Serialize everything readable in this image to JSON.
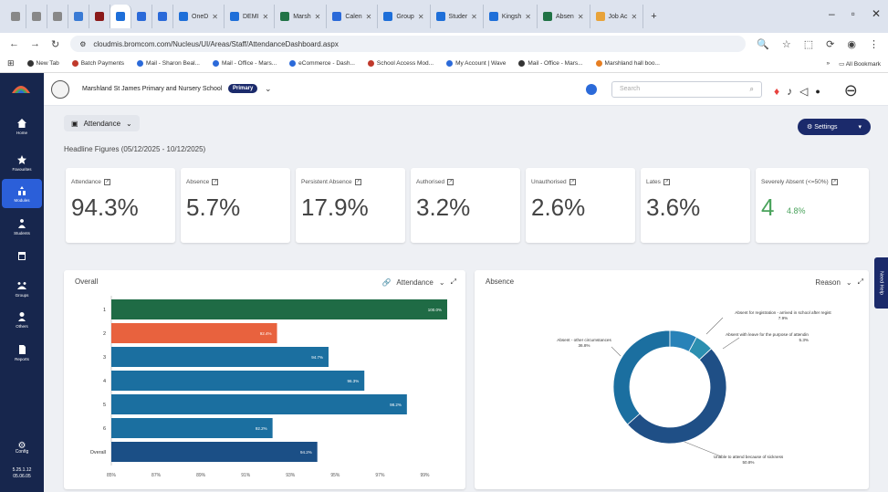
{
  "browser": {
    "tabs": [
      {
        "label": "",
        "color": "#888888"
      },
      {
        "label": "",
        "color": "#888888"
      },
      {
        "label": "",
        "color": "#888888"
      },
      {
        "label": "",
        "color": "#3a7bd5"
      },
      {
        "label": "",
        "color": "#8b1a1a"
      },
      {
        "label": "",
        "color": "#1e6fd9",
        "active": true
      },
      {
        "label": "",
        "color": "#2b6ad9"
      },
      {
        "label": "",
        "color": "#2b6ad9"
      },
      {
        "label": "OneD",
        "color": "#1e6fd9"
      },
      {
        "label": "DEMI",
        "color": "#1e6fd9"
      },
      {
        "label": "Marsh",
        "color": "#217346"
      },
      {
        "label": "Calen",
        "color": "#2b6ad9"
      },
      {
        "label": "Group",
        "color": "#1e6fd9"
      },
      {
        "label": "Studer",
        "color": "#1e6fd9"
      },
      {
        "label": "Kingsh",
        "color": "#1e6fd9"
      },
      {
        "label": "Absen",
        "color": "#217346"
      },
      {
        "label": "Job Ac",
        "color": "#e8a33a"
      }
    ],
    "url": "cloudmis.bromcom.com/Nucleus/UI/Areas/Staff/AttendanceDashboard.aspx",
    "bookmarks": [
      {
        "label": "New Tab",
        "color": "#333333"
      },
      {
        "label": "Batch Payments",
        "color": "#c0392b"
      },
      {
        "label": "Mail - Sharon Beal...",
        "color": "#2b6ad9"
      },
      {
        "label": "Mail - Office - Mars...",
        "color": "#2b6ad9"
      },
      {
        "label": "eCommerce - Dash...",
        "color": "#2b6ad9"
      },
      {
        "label": "School Access Mod...",
        "color": "#c0392b"
      },
      {
        "label": "My Account | Wave",
        "color": "#2b6ad9"
      },
      {
        "label": "Mail - Office - Mars...",
        "color": "#333333"
      },
      {
        "label": "Marshland hall boo...",
        "color": "#e67e22"
      }
    ],
    "all_bookmarks": "All Bookmark"
  },
  "sidebar": {
    "items": [
      {
        "label": "Home",
        "icon": "home-icon"
      },
      {
        "label": "Favourites",
        "icon": "star-icon"
      },
      {
        "label": "Modules",
        "icon": "modules-icon",
        "active": true
      },
      {
        "label": "Students",
        "icon": "students-icon"
      },
      {
        "label": "",
        "icon": "calendar-icon"
      },
      {
        "label": "Groups",
        "icon": "groups-icon"
      },
      {
        "label": "Others",
        "icon": "others-icon"
      },
      {
        "label": "Reports",
        "icon": "reports-icon"
      }
    ],
    "config_label": "Config",
    "time": "5.25.1.12",
    "build": "05.06.05"
  },
  "header": {
    "school_name": "Marshland St James Primary and Nursery School",
    "badge": "Primary",
    "search_placeholder": "Search"
  },
  "main": {
    "dashboard_select": "Attendance",
    "settings_label": "Settings",
    "headline": "Headline Figures (05/12/2025 - 10/12/2025)",
    "kpis": [
      {
        "label": "Attendance",
        "value": "94.3%"
      },
      {
        "label": "Absence",
        "value": "5.7%"
      },
      {
        "label": "Persistent Absence",
        "value": "17.9%"
      },
      {
        "label": "Authorised",
        "value": "3.2%"
      },
      {
        "label": "Unauthorised",
        "value": "2.6%"
      },
      {
        "label": "Lates",
        "value": "3.6%"
      },
      {
        "label": "Severely Absent (<=50%)",
        "value": "4",
        "sub": "4.8%",
        "green": true
      }
    ]
  },
  "chart_data": [
    {
      "type": "bar",
      "orientation": "horizontal",
      "title": "Overall",
      "selector": "Attendance",
      "categories": [
        "1",
        "2",
        "3",
        "4",
        "5",
        "6",
        "Overall"
      ],
      "values": [
        100.0,
        92.4,
        94.7,
        96.3,
        98.2,
        92.2,
        94.2
      ],
      "value_labels": [
        "100.0%",
        "92.4%",
        "94.7%",
        "96.3%",
        "98.2%",
        "92.2%",
        "94.2%"
      ],
      "colors": [
        "#1f6b45",
        "#e8623e",
        "#1b6fa0",
        "#1b6fa0",
        "#1b6fa0",
        "#1b6fa0",
        "#1b4f86"
      ],
      "xlim": [
        85,
        100
      ],
      "xticks": [
        "85%",
        "87%",
        "89%",
        "91%",
        "93%",
        "95%",
        "97%",
        "99%"
      ]
    },
    {
      "type": "pie",
      "donut": true,
      "title": "Absence",
      "selector": "Reason",
      "slices": [
        {
          "label": "Unable to attend because of sickness",
          "value": 50.8,
          "color": "#1f4f86"
        },
        {
          "label": "Absent - other circumstances",
          "value": 36.8,
          "color": "#1b6fa0"
        },
        {
          "label": "Absent for registration - arrived in school after regist",
          "value": 7.9,
          "color": "#2882b8"
        },
        {
          "label": "Absent with leave for the purpose of attendin",
          "value": 5.3,
          "color": "#2c8fb0"
        }
      ],
      "value_labels": [
        "50.8%",
        "36.8%",
        "7.9%",
        "5.3%"
      ]
    }
  ],
  "need_help": "Need Help"
}
